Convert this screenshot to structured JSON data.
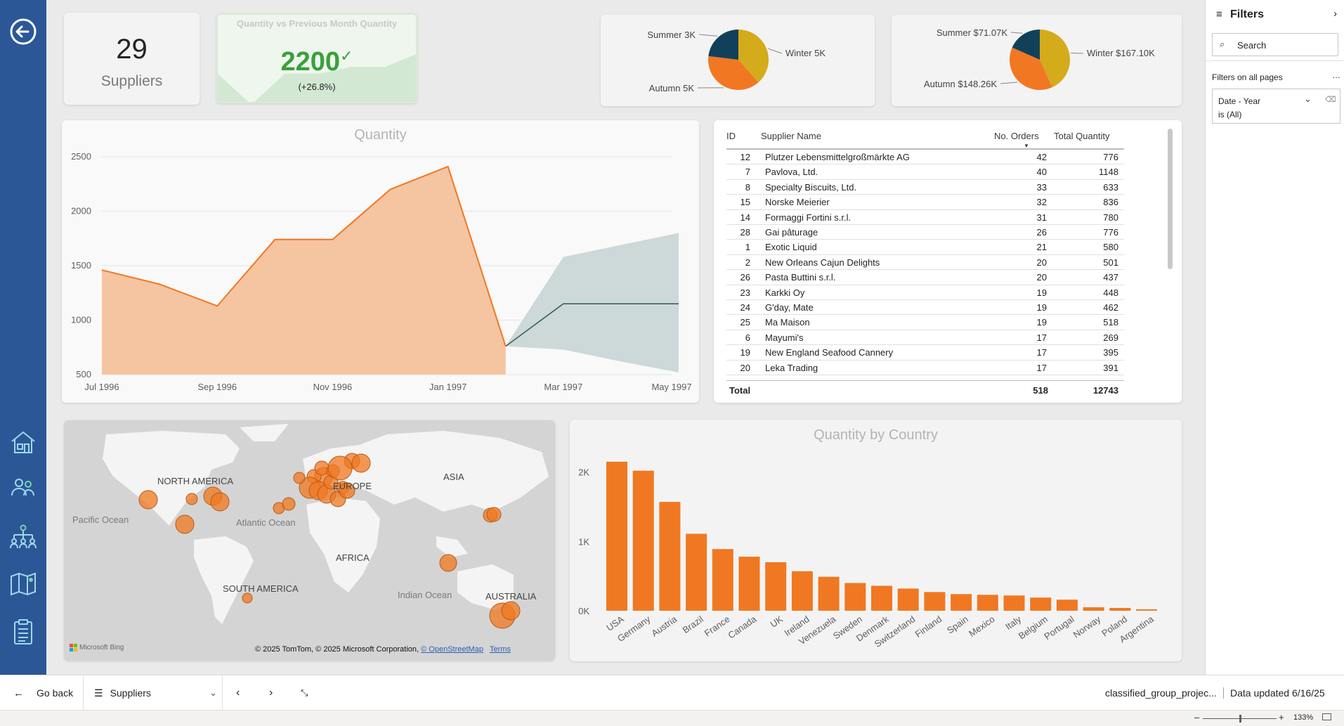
{
  "kpi_suppliers": {
    "value": "29",
    "label": "Suppliers"
  },
  "kpi_qty": {
    "title": "Quantity vs Previous Month Quantity",
    "value": "2200",
    "delta": "(+26.8%)",
    "spark": [
      0.55,
      1.0,
      0.55,
      0.55,
      0.45,
      0.45,
      0.25
    ]
  },
  "pie_qty": {
    "slices": [
      {
        "name": "Winter",
        "label": "Winter 5K",
        "value": 5,
        "color": "#d4ab1b"
      },
      {
        "name": "Autumn",
        "label": "Autumn 5K",
        "value": 5,
        "color": "#f07822"
      },
      {
        "name": "Summer",
        "label": "Summer 3K",
        "value": 3,
        "color": "#11415a"
      }
    ]
  },
  "pie_sales": {
    "slices": [
      {
        "name": "Winter",
        "label": "Winter $167.10K",
        "value": 167.1,
        "color": "#d4ab1b"
      },
      {
        "name": "Autumn",
        "label": "Autumn $148.26K",
        "value": 148.26,
        "color": "#f07822"
      },
      {
        "name": "Summer",
        "label": "Summer $71.07K",
        "value": 71.07,
        "color": "#11415a"
      }
    ]
  },
  "chart_data": [
    {
      "type": "area",
      "title": "Quantity",
      "ylim": [
        500,
        2500
      ],
      "yticks": [
        "2500",
        "2000",
        "1500",
        "1000",
        "500"
      ],
      "xticks": [
        "Jul 1996",
        "Sep 1996",
        "Nov 1996",
        "Jan 1997",
        "Mar 1997",
        "May 1997"
      ],
      "x": [
        "1996-07",
        "1996-08",
        "1996-09",
        "1996-10",
        "1996-11",
        "1996-12",
        "1997-01",
        "1997-02"
      ],
      "values": [
        1460,
        1330,
        1130,
        1740,
        1740,
        2200,
        2410,
        760
      ],
      "forecast": {
        "x": [
          "1997-02",
          "1997-03",
          "1997-04",
          "1997-05"
        ],
        "values": [
          760,
          1150,
          1150,
          1150
        ],
        "upper": [
          760,
          1580,
          1690,
          1800
        ],
        "lower": [
          760,
          730,
          620,
          520
        ]
      },
      "colors": {
        "area": "#f5c4a1",
        "line": "#f07822",
        "forecast_band": "#cdd8d8",
        "forecast_line": "#2e5a51"
      }
    },
    {
      "type": "bar",
      "title": "Quantity by Country",
      "categories": [
        "USA",
        "Germany",
        "Austria",
        "Brazil",
        "France",
        "Canada",
        "UK",
        "Ireland",
        "Venezuela",
        "Sweden",
        "Denmark",
        "Switzerland",
        "Finland",
        "Spain",
        "Mexico",
        "Italy",
        "Belgium",
        "Portugal",
        "Norway",
        "Poland",
        "Argentina"
      ],
      "values": [
        2150,
        2020,
        1570,
        1110,
        890,
        780,
        700,
        570,
        490,
        400,
        360,
        320,
        270,
        240,
        230,
        220,
        190,
        160,
        50,
        40,
        20
      ],
      "ylim": [
        0,
        2200
      ],
      "yticks": [
        "2K",
        "1K",
        "0K"
      ],
      "color": "#f07822"
    }
  ],
  "table": {
    "headers": {
      "id": "ID",
      "name": "Supplier Name",
      "orders": "No. Orders",
      "qty": "Total Quantity"
    },
    "rows": [
      {
        "id": "12",
        "name": "Plutzer Lebensmittelgroßmärkte AG",
        "orders": "42",
        "qty": "776"
      },
      {
        "id": "7",
        "name": "Pavlova, Ltd.",
        "orders": "40",
        "qty": "1148"
      },
      {
        "id": "8",
        "name": "Specialty Biscuits, Ltd.",
        "orders": "33",
        "qty": "633"
      },
      {
        "id": "15",
        "name": "Norske Meierier",
        "orders": "32",
        "qty": "836"
      },
      {
        "id": "14",
        "name": "Formaggi Fortini s.r.l.",
        "orders": "31",
        "qty": "780"
      },
      {
        "id": "28",
        "name": "Gai pâturage",
        "orders": "26",
        "qty": "776"
      },
      {
        "id": "1",
        "name": "Exotic Liquid",
        "orders": "21",
        "qty": "580"
      },
      {
        "id": "2",
        "name": "New Orleans Cajun Delights",
        "orders": "20",
        "qty": "501"
      },
      {
        "id": "26",
        "name": "Pasta Buttini s.r.l.",
        "orders": "20",
        "qty": "437"
      },
      {
        "id": "23",
        "name": "Karkki Oy",
        "orders": "19",
        "qty": "448"
      },
      {
        "id": "24",
        "name": "G'day, Mate",
        "orders": "19",
        "qty": "462"
      },
      {
        "id": "25",
        "name": "Ma Maison",
        "orders": "19",
        "qty": "518"
      },
      {
        "id": "6",
        "name": "Mayumi's",
        "orders": "17",
        "qty": "269"
      },
      {
        "id": "19",
        "name": "New England Seafood Cannery",
        "orders": "17",
        "qty": "395"
      },
      {
        "id": "20",
        "name": "Leka Trading",
        "orders": "17",
        "qty": "391"
      }
    ],
    "total": {
      "label": "Total",
      "orders": "518",
      "qty": "12743"
    }
  },
  "map": {
    "labels": {
      "na": "NORTH AMERICA",
      "eu": "EUROPE",
      "asia": "ASIA",
      "africa": "AFRICA",
      "sa": "SOUTH AMERICA",
      "au": "AUSTRALIA",
      "pacific": "Pacific Ocean",
      "atlantic": "Atlantic Ocean",
      "indian": "Indian Ocean"
    },
    "attribution": "© 2025 TomTom, © 2025 Microsoft Corporation,",
    "osm": "© OpenStreetMap",
    "terms": "Terms",
    "bing": "Microsoft Bing"
  },
  "filters": {
    "title": "Filters",
    "search_placeholder": "Search",
    "section": "Filters on all pages",
    "card_title": "Date - Year",
    "card_value": "is (All)"
  },
  "footer": {
    "go_back": "Go back",
    "page": "Suppliers",
    "file": "classified_group_projec...",
    "updated": "Data updated 6/16/25",
    "zoom": "133%"
  },
  "colors": {
    "nav": "#2b5797",
    "accent": "#f07822",
    "good": "#3aa03a"
  }
}
